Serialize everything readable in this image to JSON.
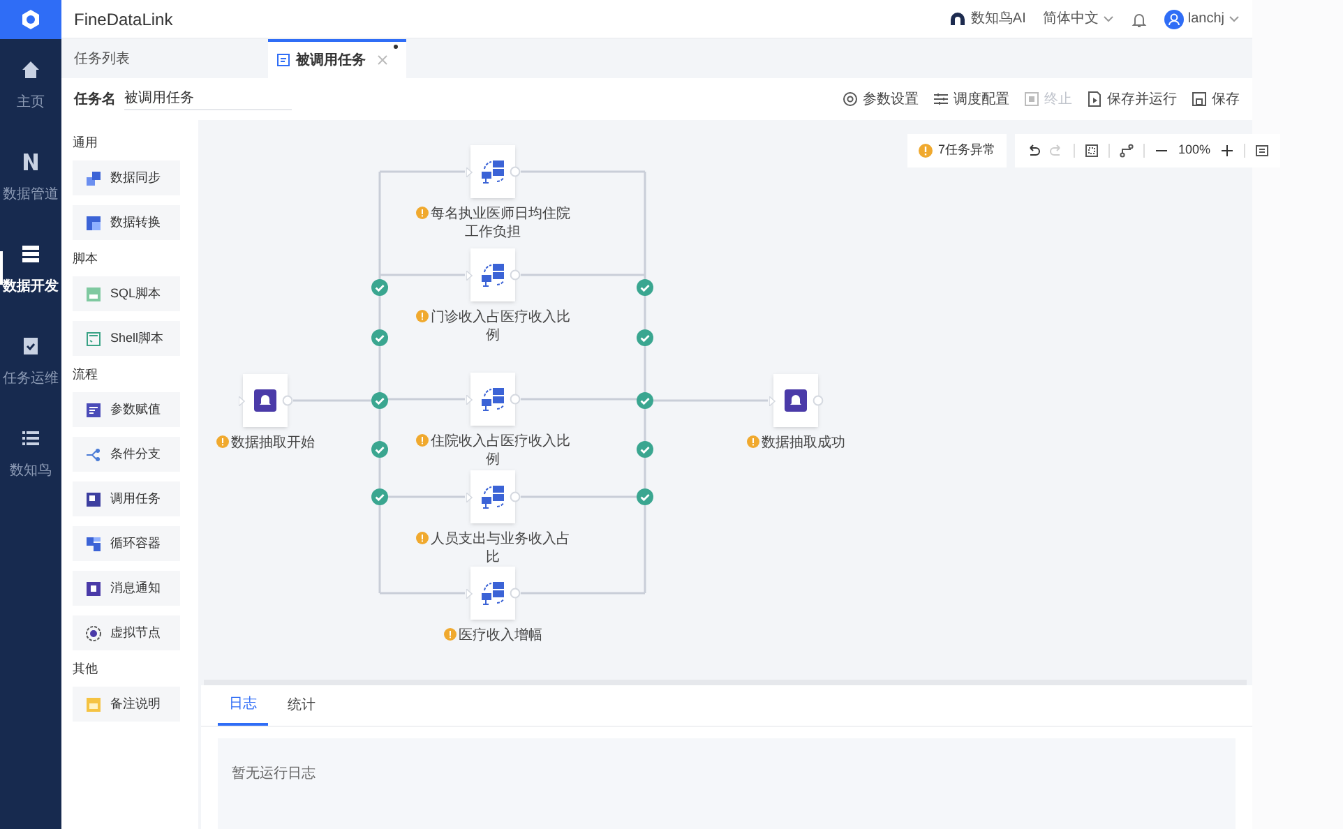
{
  "app": {
    "name": "FineDataLink"
  },
  "header": {
    "ai": "数知鸟AI",
    "language": "简体中文",
    "user": "lanchj"
  },
  "nav": [
    {
      "label": "主页",
      "selected": false
    },
    {
      "label": "数据管道",
      "selected": false
    },
    {
      "label": "数据开发",
      "selected": true
    },
    {
      "label": "任务运维",
      "selected": false
    },
    {
      "label": "数知鸟",
      "selected": false
    }
  ],
  "tabs": [
    {
      "label": "任务列表",
      "selected": false,
      "closable": false
    },
    {
      "label": "被调用任务",
      "selected": true,
      "closable": true,
      "modified": true
    }
  ],
  "task_name": {
    "label": "任务名",
    "value": "被调用任务"
  },
  "actions": [
    {
      "label": "参数设置",
      "disabled": false
    },
    {
      "label": "调度配置",
      "disabled": false
    },
    {
      "label": "终止",
      "disabled": true
    },
    {
      "label": "保存并运行",
      "disabled": false
    },
    {
      "label": "保存",
      "disabled": false
    }
  ],
  "palette": [
    {
      "title": "通用",
      "items": [
        {
          "label": "数据同步",
          "kind": "sync"
        },
        {
          "label": "数据转换",
          "kind": "transform"
        }
      ]
    },
    {
      "title": "脚本",
      "items": [
        {
          "label": "SQL脚本",
          "kind": "sql"
        },
        {
          "label": "Shell脚本",
          "kind": "shell"
        }
      ]
    },
    {
      "title": "流程",
      "items": [
        {
          "label": "参数赋值",
          "kind": "param"
        },
        {
          "label": "条件分支",
          "kind": "branch"
        },
        {
          "label": "调用任务",
          "kind": "call"
        },
        {
          "label": "循环容器",
          "kind": "loop"
        },
        {
          "label": "消息通知",
          "kind": "notify"
        },
        {
          "label": "虚拟节点",
          "kind": "virtual"
        }
      ]
    },
    {
      "title": "其他",
      "items": [
        {
          "label": "备注说明",
          "kind": "note"
        }
      ]
    }
  ],
  "canvas_toolbar": {
    "warning": "7任务异常",
    "zoom": "100%"
  },
  "nodes": [
    {
      "kind": "notify",
      "label": "数据抽取开始",
      "warning": true
    },
    {
      "kind": "task",
      "label": "每名执业医师日均住院工作负担",
      "warning": true
    },
    {
      "kind": "task",
      "label": "门诊收入占医疗收入比例",
      "warning": true
    },
    {
      "kind": "task",
      "label": "住院收入占医疗收入比例",
      "warning": true
    },
    {
      "kind": "task",
      "label": "人员支出与业务收入占比",
      "warning": true
    },
    {
      "kind": "task",
      "label": "医疗收入增幅",
      "warning": true
    },
    {
      "kind": "notify",
      "label": "数据抽取成功",
      "warning": true
    }
  ],
  "edge_checks": [
    {
      "passed": true
    },
    {
      "passed": true
    },
    {
      "passed": true
    },
    {
      "passed": true
    },
    {
      "passed": true
    },
    {
      "passed": true
    },
    {
      "passed": true
    },
    {
      "passed": true
    },
    {
      "passed": true
    },
    {
      "passed": true
    }
  ],
  "bottom_tabs": [
    {
      "label": "日志",
      "selected": true
    },
    {
      "label": "统计",
      "selected": false
    }
  ],
  "log": {
    "empty_text": "暂无运行日志"
  }
}
